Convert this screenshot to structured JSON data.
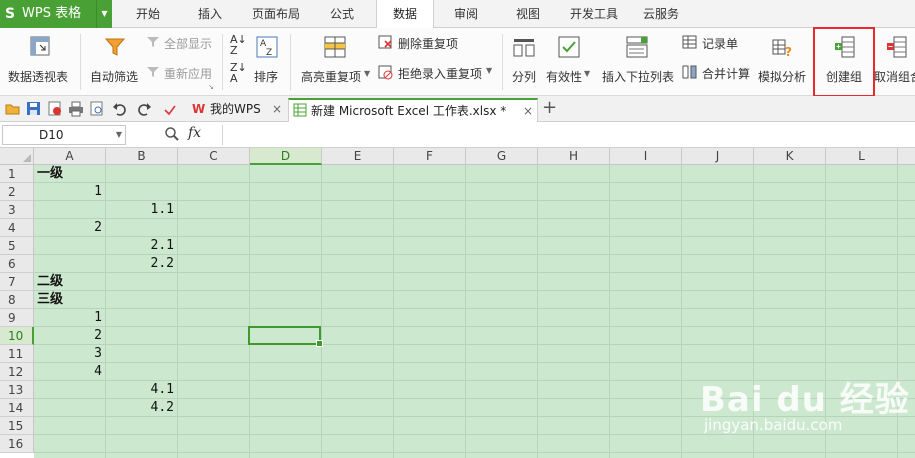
{
  "app": {
    "logo": "S",
    "title": "WPS 表格",
    "accent": "#49a035"
  },
  "menu": {
    "items": [
      "开始",
      "插入",
      "页面布局",
      "公式",
      "数据",
      "审阅",
      "视图",
      "开发工具",
      "云服务"
    ],
    "active": "数据"
  },
  "ribbon": {
    "pivot": "数据透视表",
    "autofilter": "自动筛选",
    "show_all": "全部显示",
    "reapply": "重新应用",
    "sort": "排序",
    "highlight_dup": "高亮重复项",
    "delete_dup": "删除重复项",
    "reject_dup": "拒绝录入重复项",
    "split": "分列",
    "validity": "有效性",
    "insert_dropdown": "插入下拉列表",
    "record_sheet": "记录单",
    "consolidate": "合并计算",
    "simulate": "模拟分析",
    "create_group": "创建组",
    "ungroup": "取消组合"
  },
  "tabs": {
    "my_wps": "我的WPS",
    "doc": "新建 Microsoft Excel 工作表.xlsx *",
    "add": "+"
  },
  "formula_bar": {
    "cell_ref": "D10",
    "fx": "fx",
    "value": ""
  },
  "grid": {
    "columns": [
      "A",
      "B",
      "C",
      "D",
      "E",
      "F",
      "G",
      "H",
      "I",
      "J",
      "K",
      "L"
    ],
    "selected_column": "D",
    "rows": [
      "1",
      "2",
      "3",
      "4",
      "5",
      "6",
      "7",
      "8",
      "9",
      "10",
      "11",
      "12",
      "13",
      "14",
      "15",
      "16"
    ],
    "selected_row": "10",
    "active_cell": "D10",
    "cells": [
      {
        "row": 1,
        "col": "A",
        "value": "一级",
        "bold": true
      },
      {
        "row": 2,
        "col": "A",
        "value": "1"
      },
      {
        "row": 3,
        "col": "B",
        "value": "1.1"
      },
      {
        "row": 4,
        "col": "A",
        "value": "2"
      },
      {
        "row": 5,
        "col": "B",
        "value": "2.1"
      },
      {
        "row": 6,
        "col": "B",
        "value": "2.2"
      },
      {
        "row": 7,
        "col": "A",
        "value": "二级",
        "bold": true
      },
      {
        "row": 8,
        "col": "A",
        "value": "三级",
        "bold": true
      },
      {
        "row": 9,
        "col": "A",
        "value": "1"
      },
      {
        "row": 10,
        "col": "A",
        "value": "2"
      },
      {
        "row": 11,
        "col": "A",
        "value": "3"
      },
      {
        "row": 12,
        "col": "A",
        "value": "4"
      },
      {
        "row": 13,
        "col": "B",
        "value": "4.1"
      },
      {
        "row": 14,
        "col": "B",
        "value": "4.2"
      }
    ]
  },
  "watermark": {
    "logo": "Bai du 经验",
    "url": "jingyan.baidu.com"
  }
}
